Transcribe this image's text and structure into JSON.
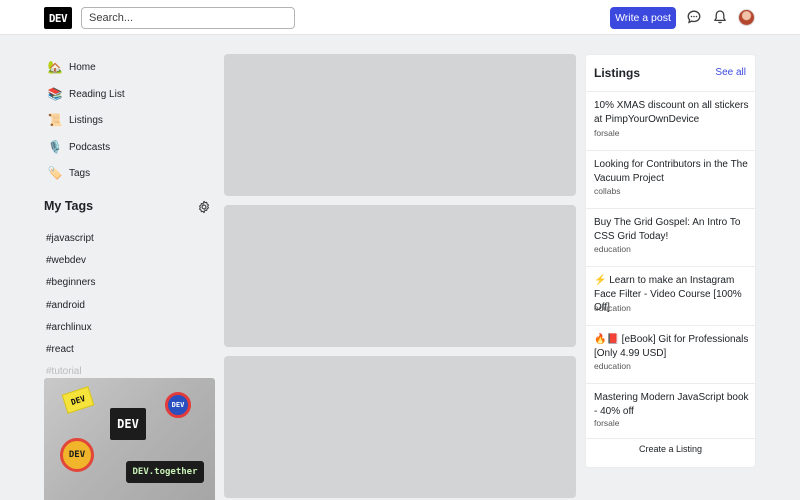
{
  "header": {
    "logo": "DEV",
    "search_placeholder": "Search...",
    "write_post": "Write a post"
  },
  "nav": [
    {
      "icon": "🏡",
      "label": "Home"
    },
    {
      "icon": "📚",
      "label": "Reading List"
    },
    {
      "icon": "📜",
      "label": "Listings"
    },
    {
      "icon": "🎙️",
      "label": "Podcasts"
    },
    {
      "icon": "🏷️",
      "label": "Tags"
    }
  ],
  "my_tags": {
    "title": "My Tags",
    "tags": [
      "#javascript",
      "#webdev",
      "#beginners",
      "#android",
      "#archlinux",
      "#react",
      "#tutorial"
    ]
  },
  "banner": {
    "stickers": [
      "DEV",
      "DEV",
      "DEV",
      "DEV",
      "DEV.together"
    ]
  },
  "listings": {
    "title": "Listings",
    "see_all": "See all",
    "items": [
      {
        "title": "10% XMAS discount on all stickers at PimpYourOwnDevice",
        "category": "forsale"
      },
      {
        "title": "Looking for Contributors in the The Vacuum Project",
        "category": "collabs"
      },
      {
        "title": "Buy The Grid Gospel: An Intro To CSS Grid Today!",
        "category": "education"
      },
      {
        "title": "⚡ Learn to make an Instagram Face Filter - Video Course [100% Off]",
        "category": "education"
      },
      {
        "title": "🔥📕 [eBook] Git for Professionals [Only 4.99 USD]",
        "category": "education"
      },
      {
        "title": "Mastering Modern JavaScript book - 40% off",
        "category": "forsale"
      }
    ],
    "create": "Create a Listing"
  }
}
